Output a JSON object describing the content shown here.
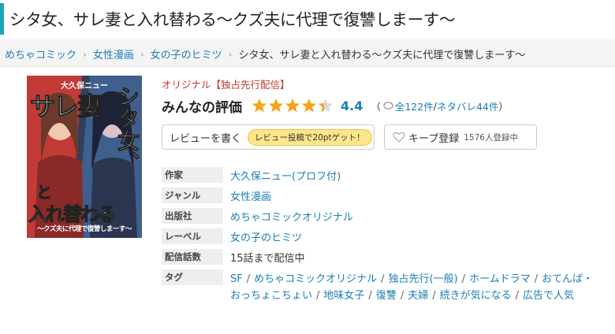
{
  "page": {
    "title": "シタ女、サレ妻と入れ替わる～クズ夫に代理で復讐しまーす～"
  },
  "breadcrumb": {
    "items": [
      "めちゃコミック",
      "女性漫画",
      "女の子のヒミツ"
    ],
    "current": "シタ女、サレ妻と入れ替わる～クズ夫に代理で復讐しまーす～"
  },
  "cover": {
    "author": "大久保ニュー",
    "title_lines": [
      "シタ女、",
      "サレ妻",
      "と",
      "入れ替わる"
    ],
    "subtitle": "～クズ夫に代理で復讐しまーす～"
  },
  "book": {
    "label": "オリジナル【独占先行配信】",
    "rating_title": "みんなの評価",
    "rating": 4.4,
    "rating_text": "4.4",
    "counts_prefix": "（",
    "counts_total": "全122件",
    "counts_sep": "/",
    "counts_spoiler": "ネタバレ44件",
    "counts_suffix": "）"
  },
  "actions": {
    "review_label": "レビューを書く",
    "review_promo": "レビュー投稿で20ptゲット！",
    "keep_label": "キープ登録",
    "keep_count": "1576人登録中"
  },
  "info": {
    "author_key": "作家",
    "author_val": "大久保ニュー(プロフ付)",
    "genre_key": "ジャンル",
    "genre_val": "女性漫画",
    "publisher_key": "出版社",
    "publisher_val": "めちゃコミックオリジナル",
    "label_key": "レーベル",
    "label_val": "女の子のヒミツ",
    "episodes_key": "配信話数",
    "episodes_val": "15話まで配信中",
    "tags_key": "タグ"
  },
  "tags": [
    "SF",
    "めちゃコミックオリジナル",
    "独占先行(一般)",
    "ホームドラマ",
    "おてんば・おっちょこちょい",
    "地味女子",
    "復讐",
    "夫婦",
    "続きが気になる",
    "広告で人気"
  ],
  "colors": {
    "accent": "#1aa6b7",
    "link": "#1a7db5",
    "star": "#f2a41b",
    "label_red": "#c0392b",
    "promo_yellow": "#fde58a"
  }
}
